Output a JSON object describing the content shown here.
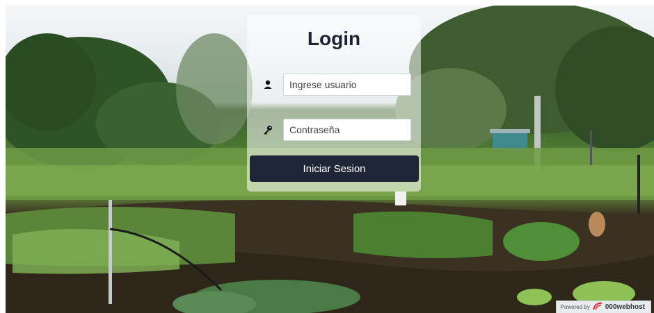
{
  "login": {
    "title": "Login",
    "username_placeholder": "Ingrese usuario",
    "password_placeholder": "Contraseña",
    "submit_label": "Iniciar Sesion"
  },
  "icons": {
    "username": "user-icon",
    "password": "key-icon",
    "brand": "000webhost-logo-icon"
  },
  "footer_badge": {
    "label": "Powered by",
    "brand": "000webhost"
  },
  "colors": {
    "button_bg": "#1f2736",
    "title_text": "#1c2433",
    "card_bg": "rgba(255,255,255,0.55)",
    "brand_red": "#e0363c"
  }
}
